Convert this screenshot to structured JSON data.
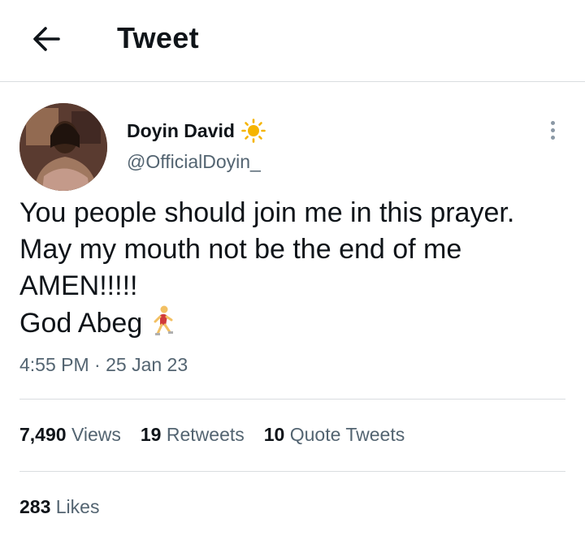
{
  "header": {
    "title": "Tweet",
    "back_icon": "arrow-left-icon"
  },
  "author": {
    "name": "Doyin David",
    "handle": "@OfficialDoyin_",
    "name_emoji": "sun-icon",
    "avatar": "profile-photo"
  },
  "tweet": {
    "lines": [
      "You people should join me in this prayer.",
      "May my mouth not be the end of me",
      "AMEN!!!!!",
      "God Abeg"
    ],
    "trailing_emoji": "woman-running-icon",
    "timestamp": "4:55 PM · 25 Jan 23"
  },
  "stats": {
    "views_count": "7,490",
    "views_label": "Views",
    "retweets_count": "19",
    "retweets_label": "Retweets",
    "quotes_count": "10",
    "quotes_label": "Quote Tweets",
    "likes_count": "283",
    "likes_label": "Likes"
  },
  "colors": {
    "text": "#0f1419",
    "secondary": "#536471",
    "divider": "#d9dde0",
    "accent_sun": "#f5b400"
  }
}
